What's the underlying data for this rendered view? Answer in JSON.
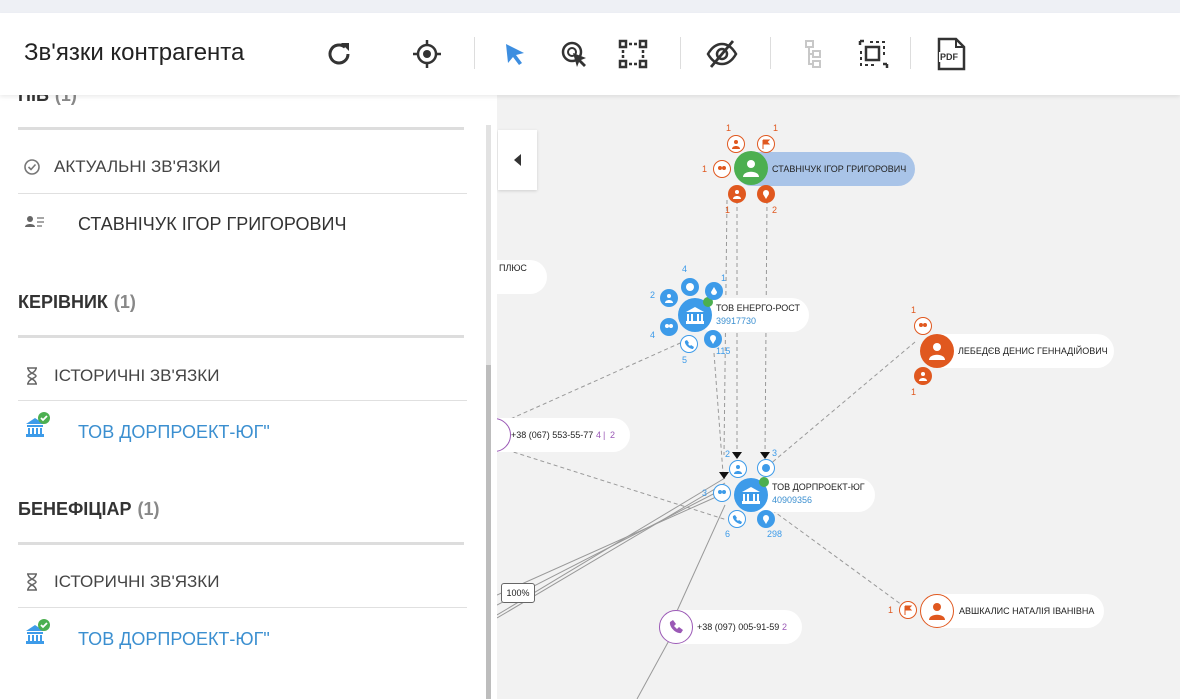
{
  "toolbar": {
    "title": "Зв'язки контрагента",
    "icons": [
      "refresh-icon",
      "target-icon",
      "cursor-icon",
      "select-click-icon",
      "select-box-icon",
      "hide-icon",
      "tree-icon",
      "crop-icon",
      "pdf-icon"
    ],
    "pdf_label": "PDF"
  },
  "sidebar": {
    "cut_title": "ПІБ",
    "cut_count": "(1)",
    "pib_sub": "АКТУАЛЬНІ ЗВ'ЯЗКИ",
    "pib_entry": "СТАВНІЧУК ІГОР ГРИГОРОВИЧ",
    "sections": [
      {
        "title": "КЕРІВНИК",
        "count": "(1)",
        "sub": "ІСТОРИЧНІ ЗВ'ЯЗКИ",
        "entry": "ТОВ ДОРПРОЕКТ-ЮГ\""
      },
      {
        "title": "БЕНЕФІЦІАР",
        "count": "(1)",
        "sub": "ІСТОРИЧНІ ЗВ'ЯЗКИ",
        "entry": "ТОВ ДОРПРОЕКТ-ЮГ\""
      }
    ]
  },
  "graph": {
    "zoom": "100%",
    "colors": {
      "person_green": "#4caf50",
      "person_orange": "#e0581f",
      "company_blue": "#3d9be9",
      "phone_purple": "#9b59b6"
    },
    "nodes": {
      "stavnichuk": {
        "name": "СТАВНІЧУК ІГОР ГРИГОРОВИЧ",
        "counts": [
          "1",
          "1",
          "1",
          "1",
          "2"
        ]
      },
      "energo": {
        "name": "ТОВ ЕНЕРГО-РОСТ",
        "code": "39917730",
        "counts": [
          "4",
          "1",
          "2",
          "4",
          "5",
          "115"
        ]
      },
      "plus": {
        "name": "Т ПЛЮС"
      },
      "lebedev": {
        "name": "ЛЕБЕДЄВ ДЕНИС ГЕННАДІЙОВИЧ",
        "counts": [
          "1",
          "1"
        ]
      },
      "phone1": {
        "name": "+38 (067) 553-55-77",
        "count_a": "4",
        "sep": "|",
        "count_b": "2"
      },
      "dorproekt": {
        "name": "ТОВ ДОРПРОЕКТ-ЮГ",
        "code": "40909356",
        "counts": [
          "2",
          "3",
          "3",
          "6",
          "298"
        ]
      },
      "phone2": {
        "name": "+38 (097) 005-91-59",
        "count": "2"
      },
      "avshkalis": {
        "name": "АВШКАЛИС НАТАЛІЯ ІВАНІВНА",
        "count": "1"
      }
    }
  }
}
